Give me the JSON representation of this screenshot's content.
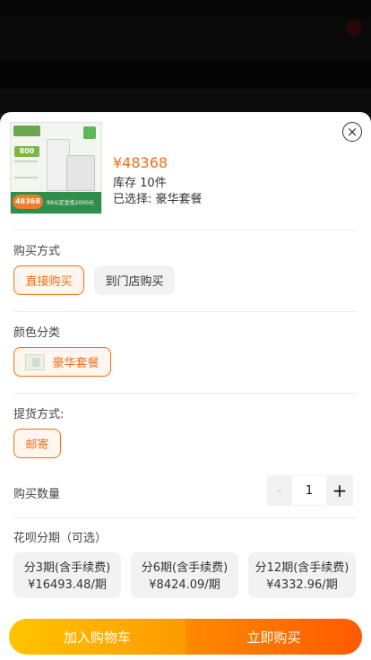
{
  "status_bar": {
    "carrier": "",
    "time": "",
    "battery": ""
  },
  "product": {
    "price": "¥48368",
    "stock": "库存 10件",
    "selected": "已选择: 豪华套餐",
    "image_price": "48368",
    "image_headline": "800",
    "image_promo": "99元定金抵2000元"
  },
  "purchase_method": {
    "title": "购买方式",
    "options": [
      {
        "label": "直接购买",
        "active": true
      },
      {
        "label": "到门店购买",
        "active": false
      }
    ]
  },
  "color": {
    "title": "颜色分类",
    "options": [
      {
        "label": "豪华套餐",
        "active": true
      }
    ]
  },
  "pickup": {
    "title": "提货方式:",
    "options": [
      {
        "label": "邮寄",
        "active": true
      }
    ]
  },
  "quantity": {
    "title": "购买数量",
    "minus": "-",
    "value": "1",
    "plus": "+"
  },
  "installments": {
    "title": "花呗分期（可选）",
    "options": [
      {
        "label": "分3期(含手续费)",
        "amount": "¥16493.48/期"
      },
      {
        "label": "分6期(含手续费)",
        "amount": "¥8424.09/期"
      },
      {
        "label": "分12期(含手续费)",
        "amount": "¥4332.96/期"
      }
    ]
  },
  "actions": {
    "add_to_cart": "加入购物车",
    "buy_now": "立即购买"
  },
  "close": "×",
  "colors": {
    "accent": "#f36e17",
    "cart_gradient_start": "#ffc400",
    "buy_gradient_end": "#ff5a00"
  }
}
